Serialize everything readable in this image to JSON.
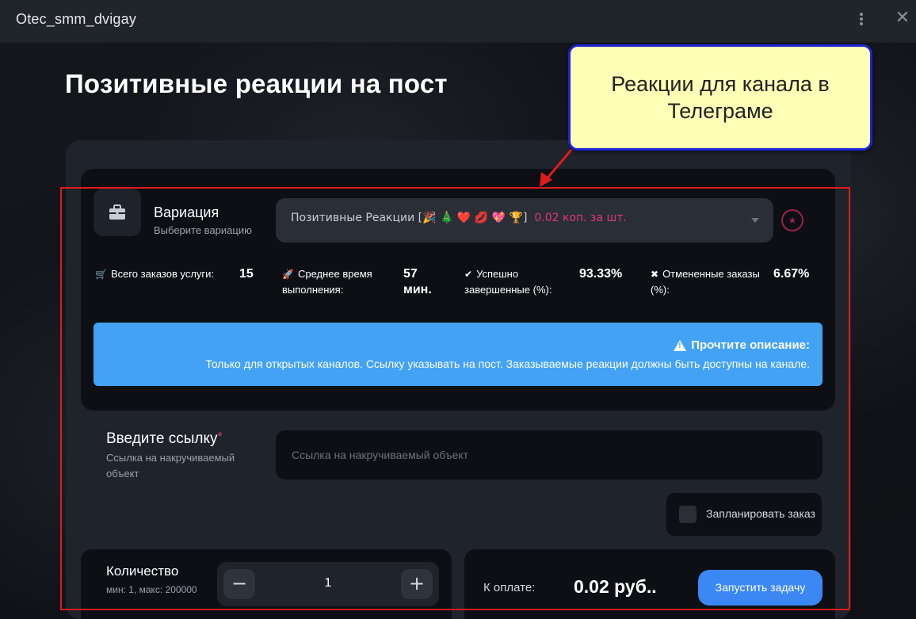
{
  "window": {
    "title": "Otec_smm_dvigay"
  },
  "page": {
    "title": "Позитивные реакции на пост"
  },
  "variation": {
    "title": "Вариация",
    "subtitle": "Выберите вариацию",
    "selected_name": "Позитивные Реакции [🎉 🎄 ❤️ 💋 💖 🏆]",
    "selected_price": "0.02 коп. за шт."
  },
  "stats": [
    {
      "icon": "cart-icon",
      "label": "Всего заказов услуги:",
      "value": "15"
    },
    {
      "icon": "rocket-icon",
      "label": "Среднее время выполнения:",
      "value": "57 мин."
    },
    {
      "icon": "check-circle-icon",
      "label": "Успешно завершенные (%):",
      "value": "93.33%"
    },
    {
      "icon": "x-square-icon",
      "label": "Отмененные заказы (%):",
      "value": "6.67%"
    }
  ],
  "notice": {
    "title": "Прочтите описание:",
    "text": "Только для открытых каналов. Ссылку указывать на пост. Заказываемые реакции должны быть доступны на канале.",
    "color": "#43a2f4"
  },
  "link": {
    "title": "Введите ссылку",
    "required_mark": "*",
    "subtitle": "Ссылка на накручиваемый объект",
    "placeholder": "Ссылка на накручиваемый объект",
    "value": ""
  },
  "schedule": {
    "label": "Запланировать заказ",
    "checked": false
  },
  "quantity": {
    "title": "Количество",
    "subtitle": "мин: 1, макс: 200000",
    "value": "1",
    "minus": "−",
    "plus": "+"
  },
  "payment": {
    "label": "К оплате:",
    "amount": "0.02 руб..",
    "button": "Запустить задачу"
  },
  "annotation": {
    "callout_text": "Реакции для канала в Телеграме",
    "callout_bg": "#fffeb6",
    "callout_border": "#1e23d6",
    "highlight_color": "#e01b1b"
  },
  "colors": {
    "accent": "#3b88f5",
    "price": "#e0357a"
  }
}
